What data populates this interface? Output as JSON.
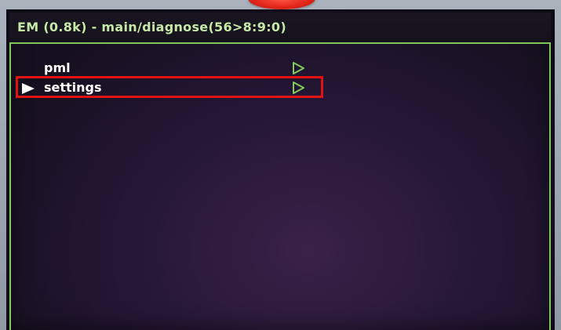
{
  "header": {
    "title": "EM (0.8k) - main/diagnose(56>8:9:0)"
  },
  "menu": {
    "items": [
      {
        "label": "pml",
        "selected": false,
        "submenu_icon": "submenu-triangle-icon"
      },
      {
        "label": "settings",
        "selected": true,
        "submenu_icon": "submenu-triangle-icon"
      }
    ]
  },
  "annotation": {
    "highlight_color": "#e01212",
    "target": "settings"
  },
  "theme": {
    "accent": "#7ec95a",
    "title_text": "#c6e8a6",
    "text": "#ffffff",
    "background": "#1a1424"
  },
  "icons": {
    "top": "red-indicator-icon",
    "selection": "selection-pointer-icon"
  }
}
